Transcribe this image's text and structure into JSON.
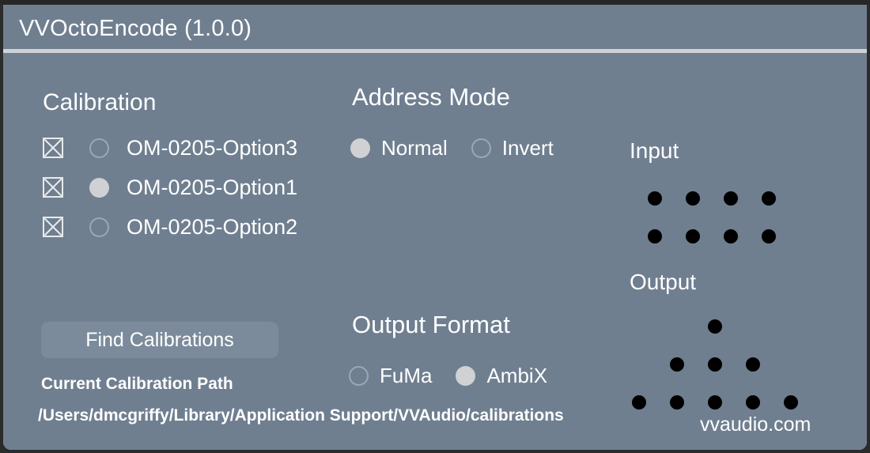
{
  "window": {
    "title": "VVOctoEncode (1.0.0)",
    "bg_color": "#6f7f90",
    "accent_color": "#cfd1d3"
  },
  "calibration": {
    "heading": "Calibration",
    "items": [
      {
        "label": "OM-0205-Option3",
        "selected": false,
        "delete_icon": "x-box-icon"
      },
      {
        "label": "OM-0205-Option1",
        "selected": true,
        "delete_icon": "x-box-icon"
      },
      {
        "label": "OM-0205-Option2",
        "selected": false,
        "delete_icon": "x-box-icon"
      }
    ],
    "find_button_label": "Find Calibrations",
    "path_label": "Current Calibration Path",
    "path_value": "/Users/dmcgriffy/Library/Application Support/VVAudio/calibrations"
  },
  "address_mode": {
    "heading": "Address Mode",
    "options": [
      {
        "label": "Normal",
        "selected": true
      },
      {
        "label": "Invert",
        "selected": false
      }
    ]
  },
  "output_format": {
    "heading": "Output Format",
    "options": [
      {
        "label": "FuMa",
        "selected": false
      },
      {
        "label": "AmbiX",
        "selected": true
      }
    ]
  },
  "io": {
    "input": {
      "heading": "Input",
      "rows": [
        4,
        4
      ]
    },
    "output": {
      "heading": "Output",
      "rows": [
        1,
        3,
        5
      ]
    }
  },
  "brand": "vvaudio.com"
}
